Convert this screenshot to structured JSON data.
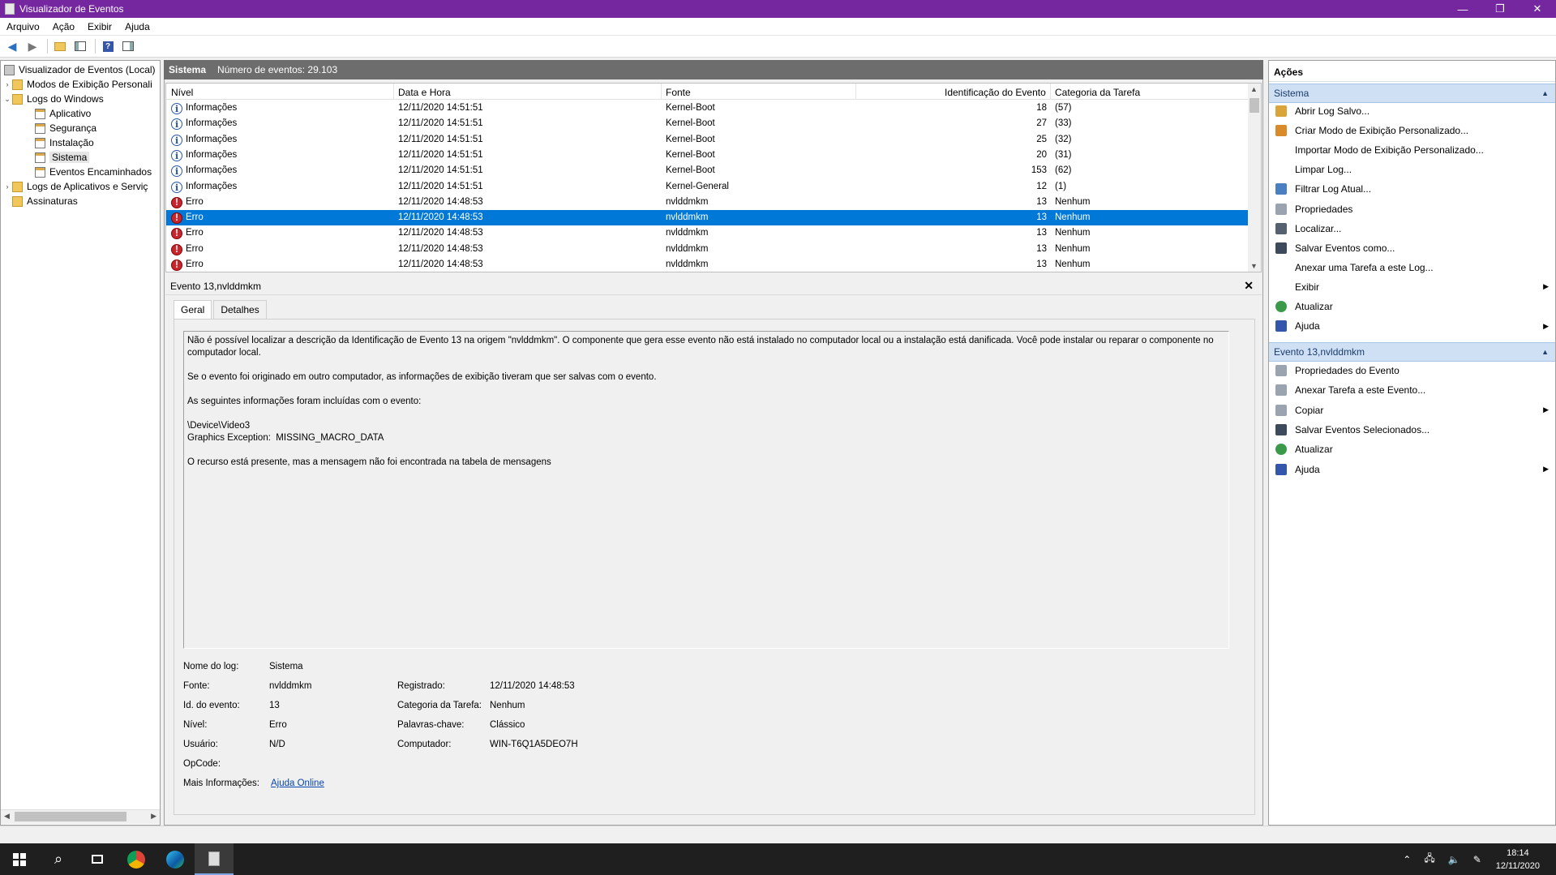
{
  "window": {
    "title": "Visualizador de Eventos",
    "controls": [
      "—",
      "❐",
      "✕"
    ]
  },
  "menu": [
    "Arquivo",
    "Ação",
    "Exibir",
    "Ajuda"
  ],
  "tree": {
    "items": [
      {
        "label": "Visualizador de Eventos (Local)",
        "icon": "event-viewer-icon"
      },
      {
        "label": "Modos de Exibição Personali",
        "icon": "folder-icon",
        "expander": "›"
      },
      {
        "label": "Logs do Windows",
        "icon": "folder-icon",
        "expander": "⌄"
      },
      {
        "label": "Aplicativo",
        "icon": "log-icon"
      },
      {
        "label": "Segurança",
        "icon": "log-icon"
      },
      {
        "label": "Instalação",
        "icon": "log-icon"
      },
      {
        "label": "Sistema",
        "icon": "log-icon",
        "selected": true
      },
      {
        "label": "Eventos Encaminhados",
        "icon": "log-icon"
      },
      {
        "label": "Logs de Aplicativos e Serviç",
        "icon": "folder-icon",
        "expander": "›"
      },
      {
        "label": "Assinaturas",
        "icon": "folder-icon"
      }
    ]
  },
  "log_header": {
    "name": "Sistema",
    "count_text": "Número de eventos: 29.103"
  },
  "columns": {
    "level": "Nível",
    "datetime": "Data e Hora",
    "source": "Fonte",
    "event_id": "Identificação do Evento",
    "category": "Categoria da Tarefa"
  },
  "events": [
    {
      "level": "Informações",
      "type": "info",
      "datetime": "12/11/2020 14:51:51",
      "source": "Kernel-Boot",
      "event_id": "18",
      "category": "(57)"
    },
    {
      "level": "Informações",
      "type": "info",
      "datetime": "12/11/2020 14:51:51",
      "source": "Kernel-Boot",
      "event_id": "27",
      "category": "(33)"
    },
    {
      "level": "Informações",
      "type": "info",
      "datetime": "12/11/2020 14:51:51",
      "source": "Kernel-Boot",
      "event_id": "25",
      "category": "(32)"
    },
    {
      "level": "Informações",
      "type": "info",
      "datetime": "12/11/2020 14:51:51",
      "source": "Kernel-Boot",
      "event_id": "20",
      "category": "(31)"
    },
    {
      "level": "Informações",
      "type": "info",
      "datetime": "12/11/2020 14:51:51",
      "source": "Kernel-Boot",
      "event_id": "153",
      "category": "(62)"
    },
    {
      "level": "Informações",
      "type": "info",
      "datetime": "12/11/2020 14:51:51",
      "source": "Kernel-General",
      "event_id": "12",
      "category": "(1)"
    },
    {
      "level": "Erro",
      "type": "error",
      "datetime": "12/11/2020 14:48:53",
      "source": "nvlddmkm",
      "event_id": "13",
      "category": "Nenhum"
    },
    {
      "level": "Erro",
      "type": "error",
      "datetime": "12/11/2020 14:48:53",
      "source": "nvlddmkm",
      "event_id": "13",
      "category": "Nenhum",
      "selected": true
    },
    {
      "level": "Erro",
      "type": "error",
      "datetime": "12/11/2020 14:48:53",
      "source": "nvlddmkm",
      "event_id": "13",
      "category": "Nenhum"
    },
    {
      "level": "Erro",
      "type": "error",
      "datetime": "12/11/2020 14:48:53",
      "source": "nvlddmkm",
      "event_id": "13",
      "category": "Nenhum"
    },
    {
      "level": "Erro",
      "type": "error",
      "datetime": "12/11/2020 14:48:53",
      "source": "nvlddmkm",
      "event_id": "13",
      "category": "Nenhum"
    }
  ],
  "detail": {
    "title": "Evento 13,nvlddmkm",
    "tabs": [
      "Geral",
      "Detalhes"
    ],
    "description": [
      "Não é possível localizar a descrição da Identificação de Evento 13 na origem \"nvlddmkm\". O componente que gera esse evento não está instalado no computador local ou a instalação está danificada. Você pode instalar ou reparar o componente no computador local.",
      "Se o evento foi originado em outro computador, as informações de exibição tiveram que ser salvas com o evento.",
      "As seguintes informações foram incluídas com o evento:",
      "\\Device\\Video3\nGraphics Exception:  MISSING_MACRO_DATA",
      "O recurso está presente, mas a mensagem não foi encontrada na tabela de mensagens"
    ],
    "props": {
      "log_name_label": "Nome do log:",
      "log_name": "Sistema",
      "source_label": "Fonte:",
      "source": "nvlddmkm",
      "logged_label": "Registrado:",
      "logged": "12/11/2020 14:48:53",
      "event_id_label": "Id. do evento:",
      "event_id": "13",
      "category_label": "Categoria da Tarefa:",
      "category": "Nenhum",
      "level_label": "Nível:",
      "level": "Erro",
      "keywords_label": "Palavras-chave:",
      "keywords": "Clássico",
      "user_label": "Usuário:",
      "user": "N/D",
      "computer_label": "Computador:",
      "computer": "WIN-T6Q1A5DEO7H",
      "opcode_label": "OpCode:",
      "more_info_label": "Mais Informações:",
      "more_info_link": "Ajuda Online"
    }
  },
  "actions": {
    "header": "Ações",
    "section1": "Sistema",
    "items1": [
      {
        "label": "Abrir Log Salvo...",
        "icon": "open-log-icon",
        "color": "#d9a43a"
      },
      {
        "label": "Criar Modo de Exibição Personalizado...",
        "icon": "filter-create-icon",
        "color": "#d98a2b"
      },
      {
        "label": "Importar Modo de Exibição Personalizado...",
        "icon": ""
      },
      {
        "label": "Limpar Log...",
        "icon": ""
      },
      {
        "label": "Filtrar Log Atual...",
        "icon": "filter-icon",
        "color": "#4a7fc1"
      },
      {
        "label": "Propriedades",
        "icon": "properties-icon",
        "color": "#9aa4b0"
      },
      {
        "label": "Localizar...",
        "icon": "find-icon",
        "color": "#556070"
      },
      {
        "label": "Salvar Eventos como...",
        "icon": "save-icon",
        "color": "#3c4a5c"
      },
      {
        "label": "Anexar uma Tarefa a este Log...",
        "icon": ""
      },
      {
        "label": "Exibir",
        "icon": "",
        "submenu": true
      },
      {
        "label": "Atualizar",
        "icon": "refresh-icon",
        "color": "#3a9a4a"
      },
      {
        "label": "Ajuda",
        "icon": "help-icon",
        "color": "#3355aa",
        "submenu": true
      }
    ],
    "section2": "Evento 13,nvlddmkm",
    "items2": [
      {
        "label": "Propriedades do Evento",
        "icon": "event-properties-icon",
        "color": "#9aa4b0"
      },
      {
        "label": "Anexar Tarefa a este Evento...",
        "icon": "attach-task-icon",
        "color": "#9aa4b0"
      },
      {
        "label": "Copiar",
        "icon": "copy-icon",
        "color": "#9aa4b0",
        "submenu": true
      },
      {
        "label": "Salvar Eventos Selecionados...",
        "icon": "save-icon",
        "color": "#3c4a5c"
      },
      {
        "label": "Atualizar",
        "icon": "refresh-icon",
        "color": "#3a9a4a"
      },
      {
        "label": "Ajuda",
        "icon": "help-icon",
        "color": "#3355aa",
        "submenu": true
      }
    ]
  },
  "taskbar": {
    "time": "18:14",
    "date": "12/11/2020"
  },
  "colors": {
    "titlebar": "#74279f",
    "selection": "#0078d7",
    "error": "#c6262e",
    "section_header": "#cfe0f5"
  }
}
